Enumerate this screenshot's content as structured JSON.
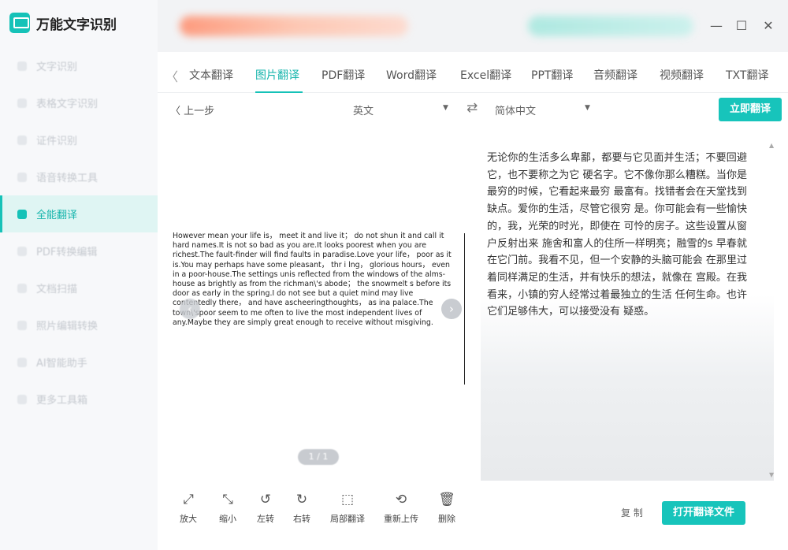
{
  "app": {
    "title": "万能文字识别"
  },
  "sidebar": {
    "items": [
      {
        "label": "文字识别"
      },
      {
        "label": "表格文字识别"
      },
      {
        "label": "证件识别"
      },
      {
        "label": "语音转换工具"
      },
      {
        "label": "全能翻译",
        "active": true
      },
      {
        "label": "PDF转换编辑"
      },
      {
        "label": "文档扫描"
      },
      {
        "label": "照片编辑转换"
      },
      {
        "label": "AI智能助手"
      },
      {
        "label": "更多工具箱"
      }
    ]
  },
  "window": {
    "minimize": "—",
    "maximize": "☐",
    "close": "✕"
  },
  "tabs": {
    "back": "〈",
    "items": [
      "文本翻译",
      "图片翻译",
      "PDF翻译",
      "Word翻译",
      "Excel翻译",
      "PPT翻译",
      "音频翻译",
      "视频翻译",
      "TXT翻译"
    ],
    "active_index": 1
  },
  "toolbar": {
    "prev_label": "〈 上一步",
    "source_lang": "英文",
    "target_lang": "简体中文",
    "caret": "▼",
    "swap": "⇄",
    "translate_label": "立即翻译"
  },
  "preview": {
    "source_text": "However mean your life is， meet it and live it； do not shun it and call it hard names.It is not so bad as you are.It looks poorest when you are richest.The fault-finder will find faults in paradise.Love your life， poor as it is.You may perhaps have some pleasant， thr i lng， glorious hours， even in a poor-house.The settings unis reflected from the windows of the alms-house as brightly as from the richman\\'s abode； the snowmelt s before its door as early in the spring.I do not see but a quiet mind may live  contentedly there， and have ascheeringthoughts， as ina palace.The town\\'spoor seem to me often to live the most independent lives of any.Maybe they are simply great enough to receive without misgiving.",
    "page_indicator": "1 / 1",
    "arrow_left": "‹",
    "arrow_right": "›"
  },
  "result": {
    "text": "无论你的生活多么卑鄙，都要与它见面并生活；不要回避它，也不要称之为它 硬名字。它不像你那么糟糕。当你是最穷的时候，它看起来最穷 最富有。找错者会在天堂找到缺点。爱你的生活，尽管它很穷 是。你可能会有一些愉快的，我，光荣的时光，即使在 可怜的房子。这些设置从窗户反射出来 施舍和富人的住所一样明亮；融雪的s 早春就在它门前。我看不见，但一个安静的头脑可能会 在那里过着同样满足的生活，并有快乐的想法，就像在 宫殿。在我看来，小镇的穷人经常过着最独立的生活 任何生命。也许它们足够伟大，可以接受没有 疑惑。"
  },
  "tools": [
    {
      "icon": "⤢",
      "label": "放大"
    },
    {
      "icon": "⤡",
      "label": "缩小"
    },
    {
      "icon": "↺",
      "label": "左转"
    },
    {
      "icon": "↻",
      "label": "右转"
    },
    {
      "icon": "⬚",
      "label": "局部翻译"
    },
    {
      "icon": "⟲",
      "label": "重新上传"
    },
    {
      "icon": "🗑",
      "label": "删除"
    }
  ],
  "actions": {
    "copy_label": "复 制",
    "open_file_label": "打开翻译文件"
  }
}
